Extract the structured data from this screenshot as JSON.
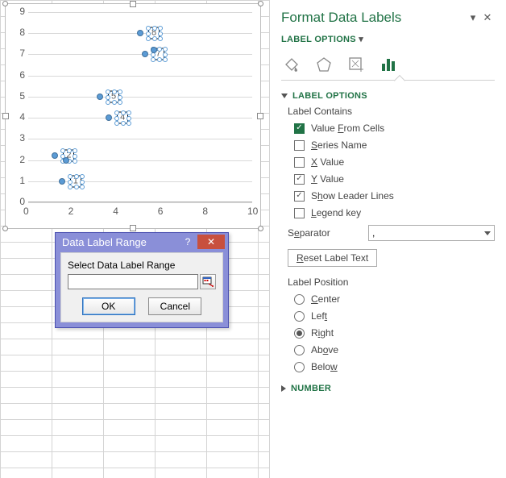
{
  "pane": {
    "title": "Format Data Labels",
    "subTitle": "LABEL OPTIONS",
    "section1": "LABEL OPTIONS",
    "labelContains": "Label Contains",
    "valueFromCells": "Value From Cells",
    "seriesName": "Series Name",
    "xValue": "X Value",
    "yValue": "Y Value",
    "leaderLines": "Show Leader Lines",
    "legendKey": "Legend key",
    "separatorLabel": "Separator",
    "separatorValue": ",",
    "resetLabel": "Reset Label Text",
    "labelPosition": "Label Position",
    "posCenter": "Center",
    "posLeft": "Left",
    "posRight": "Right",
    "posAbove": "Above",
    "posBelow": "Below",
    "section2": "NUMBER"
  },
  "dialog": {
    "title": "Data Label Range",
    "prompt": "Select Data Label Range",
    "ok": "OK",
    "cancel": "Cancel"
  },
  "chart_data": {
    "type": "scatter",
    "x": [
      1.5,
      1.2,
      1.7,
      3.6,
      3.2,
      5.2,
      5.6,
      5.0
    ],
    "y": [
      1.0,
      2.2,
      2.0,
      4.0,
      5.0,
      7.0,
      7.2,
      8.0
    ],
    "data_labels": [
      "1",
      "2",
      null,
      "4",
      "5",
      "7",
      null,
      "8"
    ],
    "xlabel": "",
    "ylabel": "",
    "xlim": [
      0,
      10
    ],
    "ylim": [
      0,
      9
    ],
    "x_ticks": [
      0,
      2,
      4,
      6,
      8,
      10
    ],
    "y_ticks": [
      0,
      1,
      2,
      3,
      4,
      5,
      6,
      7,
      8,
      9
    ],
    "grid": "horizontal",
    "series_name": "",
    "label_position": "Right"
  }
}
